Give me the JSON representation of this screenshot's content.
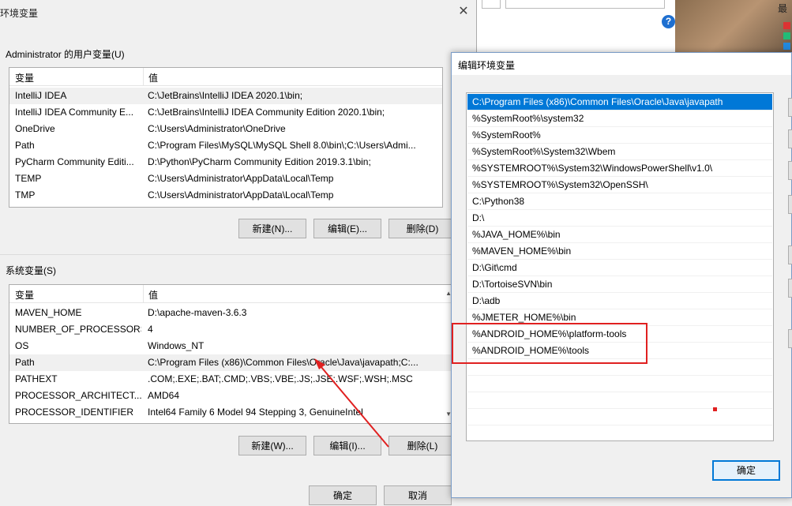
{
  "env_dialog": {
    "title": "环境变量",
    "user_group_label": "Administrator 的用户变量(U)",
    "columns": {
      "var": "变量",
      "val": "值"
    },
    "user_vars": [
      {
        "name": "IntelliJ IDEA",
        "value": "C:\\JetBrains\\IntelliJ IDEA 2020.1\\bin;"
      },
      {
        "name": "IntelliJ IDEA Community E...",
        "value": "C:\\JetBrains\\IntelliJ IDEA Community Edition 2020.1\\bin;"
      },
      {
        "name": "OneDrive",
        "value": "C:\\Users\\Administrator\\OneDrive"
      },
      {
        "name": "Path",
        "value": "C:\\Program Files\\MySQL\\MySQL Shell 8.0\\bin\\;C:\\Users\\Admi..."
      },
      {
        "name": "PyCharm Community Editi...",
        "value": "D:\\Python\\PyCharm Community Edition 2019.3.1\\bin;"
      },
      {
        "name": "TEMP",
        "value": "C:\\Users\\Administrator\\AppData\\Local\\Temp"
      },
      {
        "name": "TMP",
        "value": "C:\\Users\\Administrator\\AppData\\Local\\Temp"
      }
    ],
    "user_buttons": {
      "new": "新建(N)...",
      "edit": "编辑(E)...",
      "delete": "删除(D)"
    },
    "sys_group_label": "系统变量(S)",
    "sys_vars": [
      {
        "name": "MAVEN_HOME",
        "value": "D:\\apache-maven-3.6.3"
      },
      {
        "name": "NUMBER_OF_PROCESSORS",
        "value": "4"
      },
      {
        "name": "OS",
        "value": "Windows_NT"
      },
      {
        "name": "Path",
        "value": "C:\\Program Files (x86)\\Common Files\\Oracle\\Java\\javapath;C:..."
      },
      {
        "name": "PATHEXT",
        "value": ".COM;.EXE;.BAT;.CMD;.VBS;.VBE;.JS;.JSE;.WSF;.WSH;.MSC"
      },
      {
        "name": "PROCESSOR_ARCHITECT...",
        "value": "AMD64"
      },
      {
        "name": "PROCESSOR_IDENTIFIER",
        "value": "Intel64 Family 6 Model 94 Stepping 3, GenuineIntel"
      }
    ],
    "sys_buttons": {
      "new": "新建(W)...",
      "edit": "编辑(I)...",
      "delete": "删除(L)"
    },
    "footer_buttons": {
      "ok": "确定",
      "cancel": "取消"
    }
  },
  "edit_dialog": {
    "title": "编辑环境变量",
    "entries": [
      "C:\\Program Files (x86)\\Common Files\\Oracle\\Java\\javapath",
      "%SystemRoot%\\system32",
      "%SystemRoot%",
      "%SystemRoot%\\System32\\Wbem",
      "%SYSTEMROOT%\\System32\\WindowsPowerShell\\v1.0\\",
      "%SYSTEMROOT%\\System32\\OpenSSH\\",
      "C:\\Python38",
      "D:\\",
      "%JAVA_HOME%\\bin",
      "%MAVEN_HOME%\\bin",
      "D:\\Git\\cmd",
      "D:\\TortoiseSVN\\bin",
      "D:\\adb",
      "%JMETER_HOME%\\bin",
      "%ANDROID_HOME%\\platform-tools",
      "%ANDROID_HOME%\\tools"
    ],
    "ok_label": "确定"
  },
  "background": {
    "corner_text": "最"
  },
  "colors": {
    "selection": "#0078d7",
    "highlight": "#e02020",
    "hover": "#e5f3ff"
  }
}
